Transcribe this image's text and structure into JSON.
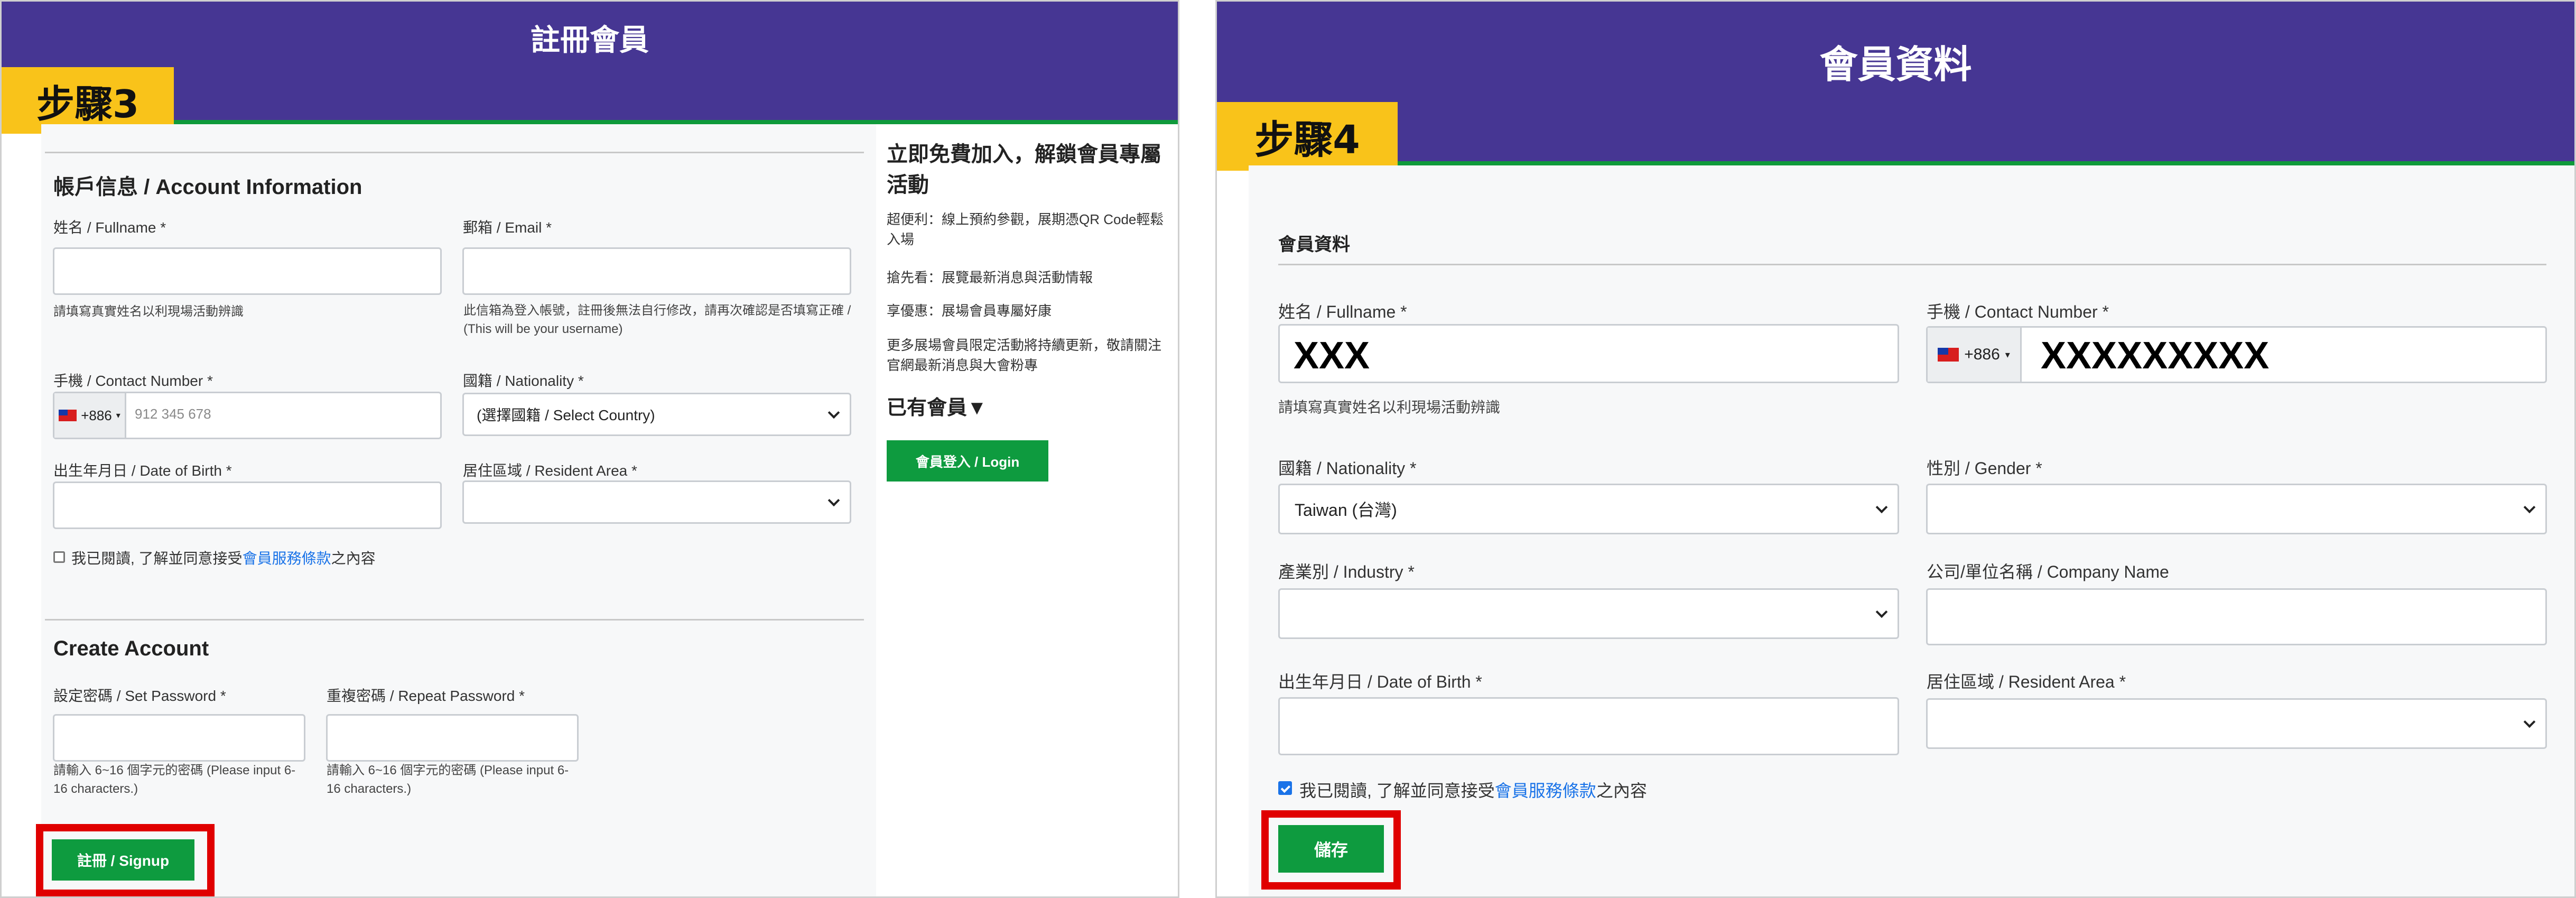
{
  "panel3": {
    "header_title": "註冊會員",
    "step_badge": "步驟3",
    "account_section": {
      "title": "帳戶信息 / Account Information",
      "fullname_label": "姓名 / Fullname *",
      "fullname_hint": "請填寫真實姓名以利現場活動辨識",
      "email_label": "郵箱 / Email *",
      "email_hint": "此信箱為登入帳號，註冊後無法自行修改，請再次確認是否填寫正確 / (This will be your username)",
      "phone_label": "手機 / Contact Number *",
      "phone_code": "+886",
      "phone_placeholder": "912 345 678",
      "nationality_label": "國籍 / Nationality *",
      "nationality_value": "(選擇國籍 / Select Country)",
      "dob_label": "出生年月日 / Date of Birth *",
      "resident_label": "居住區域 / Resident Area *",
      "consent_prefix": "我已閱讀, 了解並同意接受",
      "consent_link": "會員服務條款",
      "consent_suffix": "之內容"
    },
    "create_section": {
      "title": "Create Account",
      "password_label": "設定密碼 / Set Password *",
      "password_hint": "請輸入 6~16 個字元的密碼 (Please input 6-16 characters.)",
      "repeat_label": "重複密碼 / Repeat Password *",
      "repeat_hint": "請輸入 6~16 個字元的密碼 (Please input 6-16 characters.)",
      "signup_button": "註冊 / Signup"
    },
    "sidebar": {
      "headline": "立即免費加入，解鎖會員專屬活動",
      "benefit_1": "超便利：線上預約參觀，展期憑QR Code輕鬆入場",
      "benefit_2": "搶先看：展覽最新消息與活動情報",
      "benefit_3": "享優惠：展場會員專屬好康",
      "benefit_4": "更多展場會員限定活動將持續更新，敬請關注官網最新消息與大會粉專",
      "existing_member": "已有會員▼",
      "login_button": "會員登入 / Login"
    }
  },
  "panel4": {
    "header_title": "會員資料",
    "step_badge": "步驟4",
    "section_title": "會員資料",
    "fullname_label": "姓名 / Fullname *",
    "fullname_value": "XXX",
    "fullname_hint": "請填寫真實姓名以利現場活動辨識",
    "phone_label": "手機 / Contact Number *",
    "phone_code": "+886",
    "phone_value": "XXXXXXXXX",
    "nationality_label": "國籍 / Nationality *",
    "nationality_value": "Taiwan (台灣)",
    "gender_label": "性別 / Gender *",
    "industry_label": "產業別 / Industry *",
    "company_label": "公司/單位名稱 / Company Name",
    "dob_label": "出生年月日 / Date of Birth *",
    "resident_label": "居住區域 / Resident Area *",
    "consent_prefix": "我已閱讀, 了解並同意接受",
    "consent_link": "會員服務條款",
    "consent_suffix": "之內容",
    "save_button": "儲存"
  },
  "colors": {
    "header": "#463693",
    "accent_line": "#0f9a3b",
    "step_badge": "#f9c31a",
    "button": "#0e9b3f",
    "highlight": "#e00000",
    "link": "#1a73e8"
  }
}
